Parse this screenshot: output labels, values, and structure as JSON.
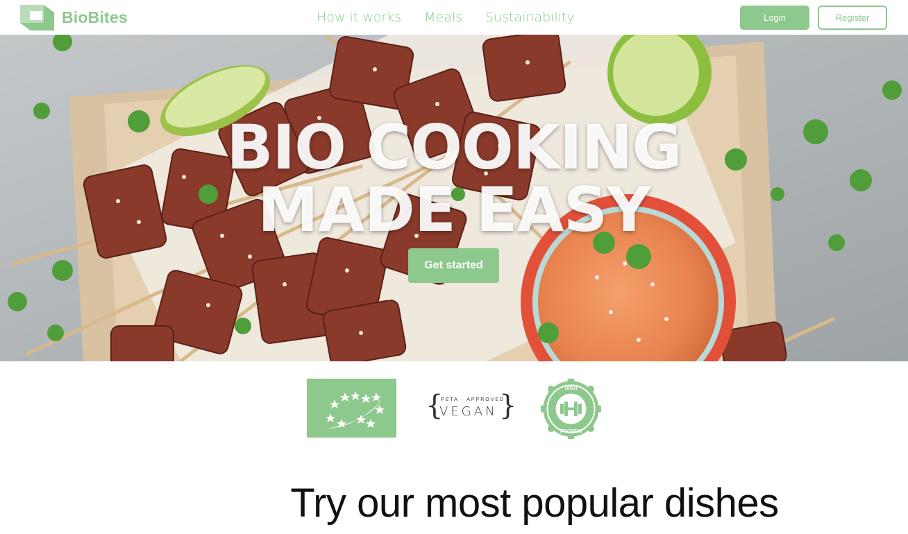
{
  "brand": {
    "name": "BioBites",
    "color": "#8dc88d"
  },
  "nav": {
    "items": [
      "How it works",
      "Meals",
      "Sustainability"
    ]
  },
  "auth": {
    "login_label": "Login",
    "register_label": "Register"
  },
  "hero": {
    "title_line1": "BIO COOKING",
    "title_line2": "MADE EASY",
    "cta_label": "Get started"
  },
  "badges": {
    "vegan_top": "PETA · APPROVED",
    "vegan_main": "VEGAN",
    "protein_top": "HIGH",
    "protein_bottom": "PROTEIN"
  },
  "section": {
    "title": "Try our most popular dishes"
  }
}
